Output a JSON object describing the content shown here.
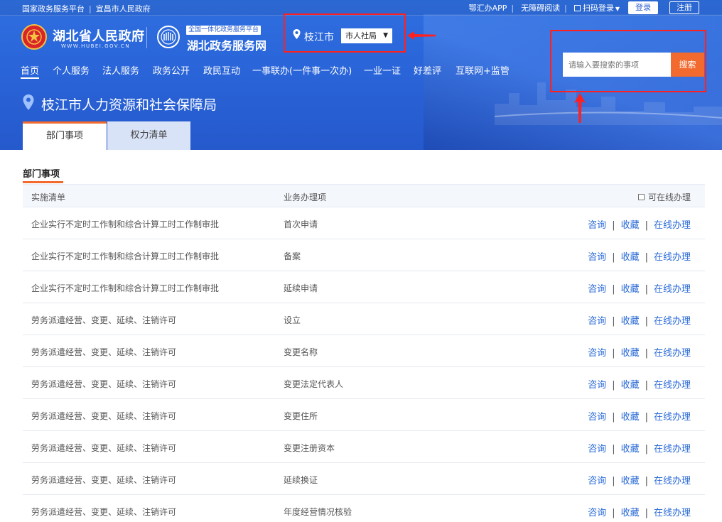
{
  "topbar": {
    "left_links": [
      "国家政务服务平台",
      "宜昌市人民政府"
    ],
    "app_link": "鄂汇办APP",
    "accessibility_link": "无障碍阅读",
    "qr_login": "扫码登录",
    "login": "登录",
    "register": "注册"
  },
  "logo": {
    "gov_name": "湖北省人民政府",
    "gov_domain": "WWW.HUBEI.GOV.CN",
    "svc_badge": "全国一体化政务服务平台",
    "svc_name": "湖北政务服务网"
  },
  "region": {
    "city": "枝江市",
    "dept_selected": "市人社局"
  },
  "search": {
    "placeholder": "请输入要搜索的事项",
    "button": "搜索"
  },
  "nav": {
    "items": [
      "首页",
      "个人服务",
      "法人服务",
      "政务公开",
      "政民互动",
      "一事联办(一件事一次办)",
      "一业一证",
      "好差评",
      "互联网+监管"
    ],
    "active": "首页"
  },
  "org": {
    "title": "枝江市人力资源和社会保障局"
  },
  "tabs": {
    "dept": "部门事项",
    "power": "权力清单"
  },
  "section": {
    "title": "部门事项"
  },
  "table": {
    "headers": {
      "list": "实施清单",
      "item": "业务办理项",
      "online_filter": "可在线办理"
    },
    "ops": {
      "consult": "咨询",
      "favorite": "收藏",
      "online": "在线办理"
    },
    "rows": [
      {
        "list": "企业实行不定时工作制和综合计算工时工作制审批",
        "item": "首次申请"
      },
      {
        "list": "企业实行不定时工作制和综合计算工时工作制审批",
        "item": "备案"
      },
      {
        "list": "企业实行不定时工作制和综合计算工时工作制审批",
        "item": "延续申请"
      },
      {
        "list": "劳务派遣经营、变更、延续、注销许可",
        "item": "设立"
      },
      {
        "list": "劳务派遣经营、变更、延续、注销许可",
        "item": "变更名称"
      },
      {
        "list": "劳务派遣经营、变更、延续、注销许可",
        "item": "变更法定代表人"
      },
      {
        "list": "劳务派遣经营、变更、延续、注销许可",
        "item": "变更住所"
      },
      {
        "list": "劳务派遣经营、变更、延续、注销许可",
        "item": "变更注册资本"
      },
      {
        "list": "劳务派遣经营、变更、延续、注销许可",
        "item": "延续换证"
      },
      {
        "list": "劳务派遣经营、变更、延续、注销许可",
        "item": "年度经营情况核验"
      }
    ]
  },
  "colors": {
    "brand_blue": "#2a66da",
    "accent_orange": "#f26a2e",
    "link_blue": "#2a6ad6",
    "highlight_red": "#ff2020"
  }
}
